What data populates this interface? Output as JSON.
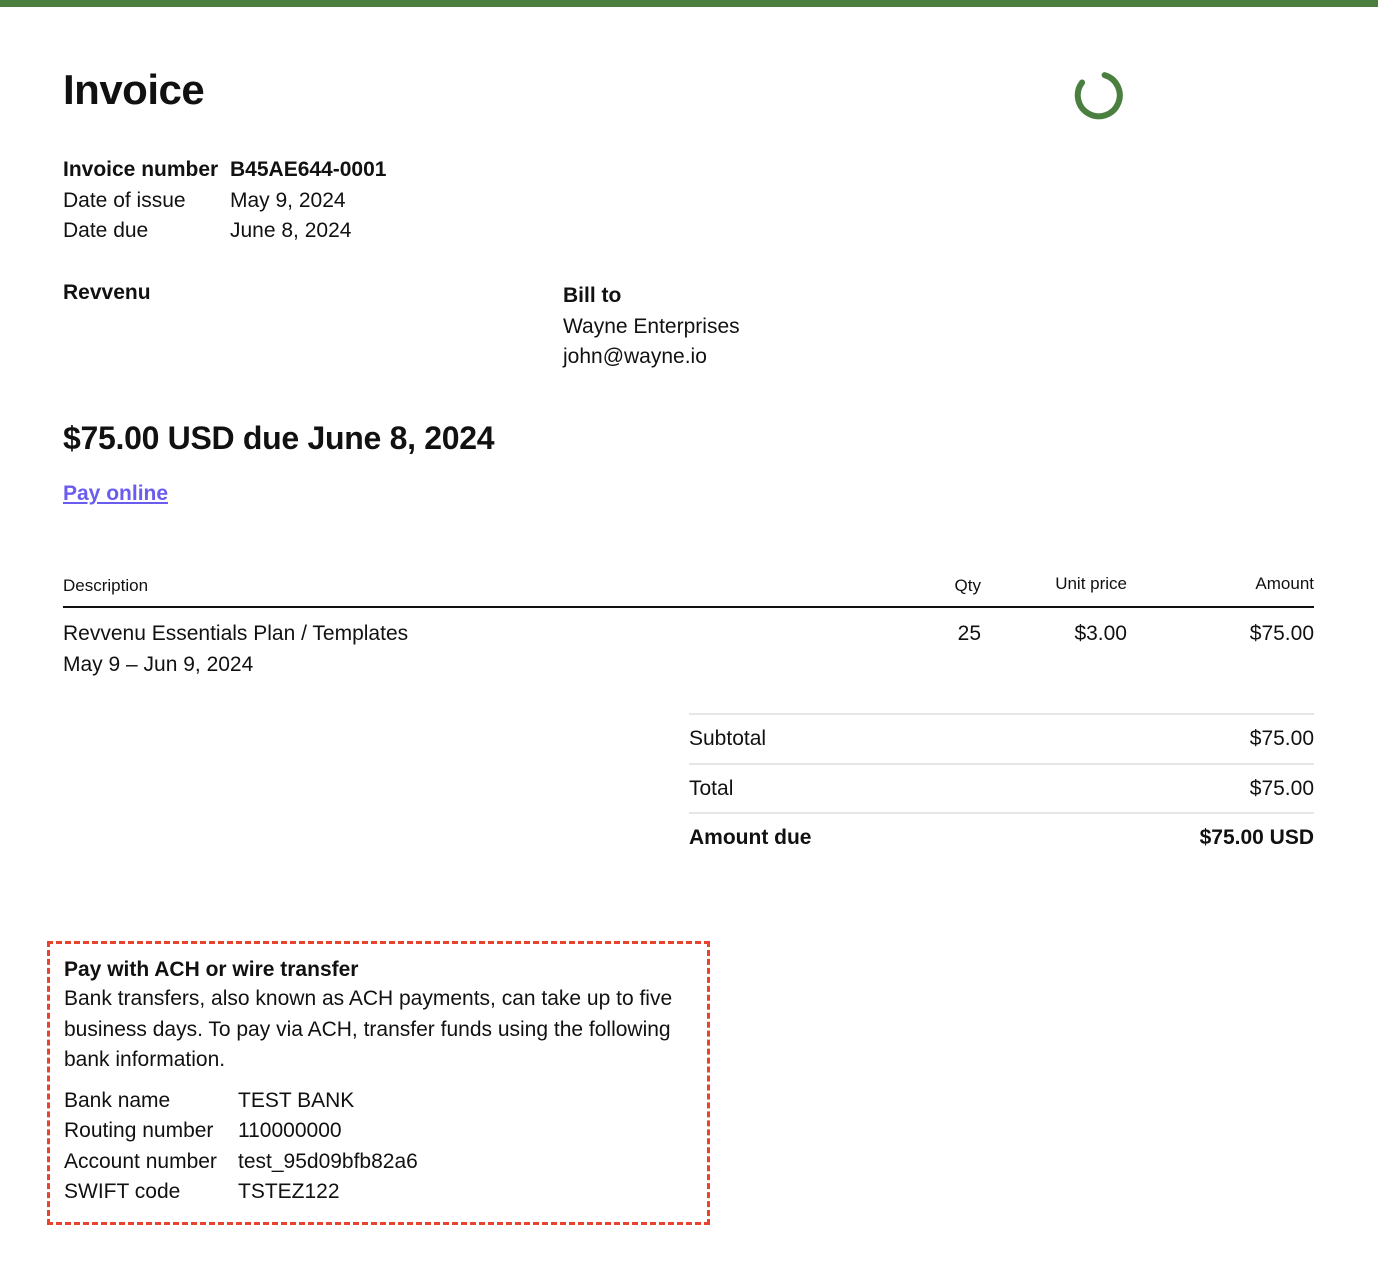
{
  "invoice": {
    "title": "Invoice",
    "meta": [
      {
        "label": "Invoice number",
        "value": "B45AE644-0001"
      },
      {
        "label": "Date of issue",
        "value": "May 9, 2024"
      },
      {
        "label": "Date due",
        "value": "June 8, 2024"
      }
    ],
    "from_name": "Revvenu",
    "bill_to": {
      "heading": "Bill to",
      "name": "Wayne Enterprises",
      "email": "john@wayne.io"
    },
    "due_heading": "$75.00 USD due June 8, 2024",
    "pay_link": "Pay online"
  },
  "items": {
    "columns": {
      "description": "Description",
      "qty": "Qty",
      "unit_price": "Unit price",
      "amount": "Amount"
    },
    "rows": [
      {
        "description": "Revvenu Essentials Plan / Templates",
        "period": "May 9 – Jun 9, 2024",
        "qty": "25",
        "unit_price": "$3.00",
        "amount": "$75.00"
      }
    ]
  },
  "totals": [
    {
      "label": "Subtotal",
      "value": "$75.00"
    },
    {
      "label": "Total",
      "value": "$75.00"
    },
    {
      "label": "Amount due",
      "value": "$75.00 USD"
    }
  ],
  "bank": {
    "title": "Pay with ACH or wire transfer",
    "description": "Bank transfers, also known as ACH payments, can take up to five business days. To pay via ACH, transfer funds using the following bank information.",
    "details": [
      {
        "label": "Bank name",
        "value": "TEST BANK"
      },
      {
        "label": "Routing number",
        "value": "110000000"
      },
      {
        "label": "Account number",
        "value": "test_95d09bfb82a6"
      },
      {
        "label": "SWIFT code",
        "value": "TSTEZ122"
      }
    ]
  },
  "colors": {
    "brand_green": "#4a7f3f",
    "link_purple": "#6b5cf0",
    "dashed_border_red": "#e8432e"
  },
  "icons": {
    "loading": "loading-spinner-icon"
  }
}
